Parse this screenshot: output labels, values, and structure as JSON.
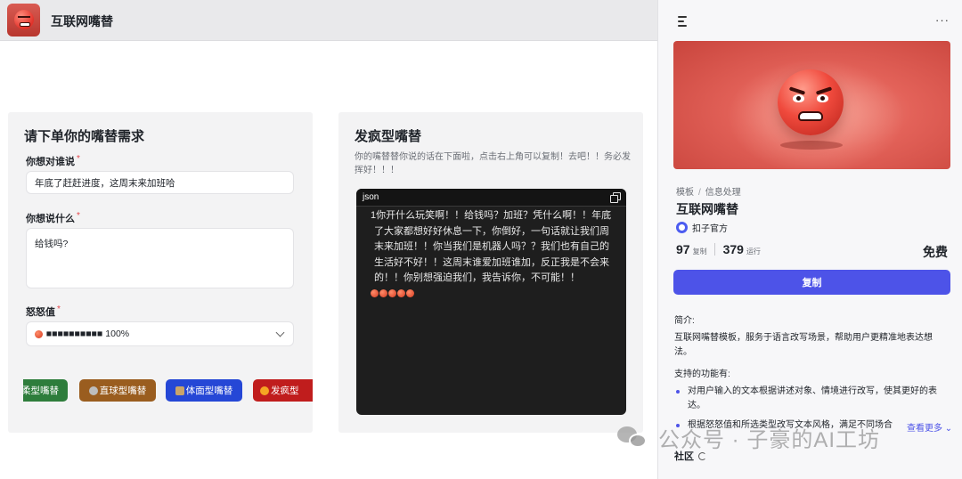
{
  "app": {
    "title": "互联网嘴替"
  },
  "input_card": {
    "title": "请下单你的嘴替需求",
    "fields": [
      {
        "label": "你想对谁说",
        "required": "*",
        "value": "年底了赶赶进度，这周末来加班哈"
      },
      {
        "label": "你想说什么",
        "required": "*",
        "value": "给钱吗?"
      },
      {
        "label": "怒怒值",
        "required": "*",
        "value": "■■■■■■■■■■ 100%"
      }
    ],
    "type_buttons": [
      {
        "label": "柔型嘴替",
        "color": "#2e7d3c"
      },
      {
        "label": "直球型嘴替",
        "color": "#9a5d1f"
      },
      {
        "label": "体面型嘴替",
        "color": "#2547d6"
      },
      {
        "label": "发疯型",
        "color": "#c01d1d"
      }
    ]
  },
  "output_card": {
    "title": "发疯型嘴替",
    "description": "你的嘴替替你说的话在下面啦，点击右上角可以复制！去吧！！务必发挥好！！！",
    "code_lang": "json",
    "code_text": "1你开什么玩笑啊！！给钱吗？加班？凭什么啊！！年底了大家都想好好休息一下，你倒好，一句话就让我们周末来加班！！你当我们是机器人吗？？我们也有自己的生活好不好！！这周末谁爱加班谁加，反正我是不会来的！！你别想强迫我们，我告诉你，不可能！！"
  },
  "panel": {
    "breadcrumb": [
      "模板",
      "信息处理"
    ],
    "title": "互联网嘴替",
    "author": "扣子官方",
    "copies": "97",
    "copies_unit": "复制",
    "runs": "379",
    "runs_unit": "运行",
    "price": "免费",
    "duplicate_label": "复制",
    "intro_label": "简介:",
    "intro_text": "互联网嘴替模板，服务于语言改写场景，帮助用户更精准地表达想法。",
    "features_label": "支持的功能有:",
    "features": [
      "对用户输入的文本根据讲述对象、情境进行改写，使其更好的表达。",
      "根据怒怒值和所选类型改写文本风格，满足不同场合"
    ],
    "see_more": "查看更多",
    "community": "社区"
  },
  "watermark": {
    "text": "公众号 · 子豪的AI工坊"
  },
  "colors": {
    "accent": "#4d53e8",
    "required": "#e5484d"
  }
}
